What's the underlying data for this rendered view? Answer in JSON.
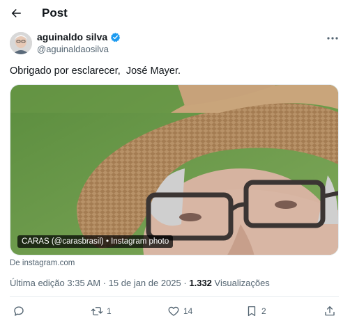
{
  "header": {
    "title": "Post"
  },
  "author": {
    "display_name": "aguinaldo silva",
    "handle": "@aguinaldaosilva",
    "verified_color": "#1d9bf0"
  },
  "tweet": {
    "text": "Obrigado por esclarecer,  José Mayer.",
    "media_label": "CARAS (@carasbrasil) • Instagram photo",
    "source": "De instagram.com"
  },
  "meta": {
    "edited": "Última edição 3:35 AM",
    "separator": "·",
    "date": "15 de jan de 2025",
    "views_count": "1.332",
    "views_label": "Visualizações"
  },
  "actions": {
    "reply_icon": "reply-icon",
    "retweet_count": "1",
    "like_count": "14",
    "bookmark_count": "2",
    "share_icon": "share-icon"
  },
  "colors": {
    "text": "#0f1419",
    "muted": "#536471",
    "accent": "#1d9bf0"
  }
}
